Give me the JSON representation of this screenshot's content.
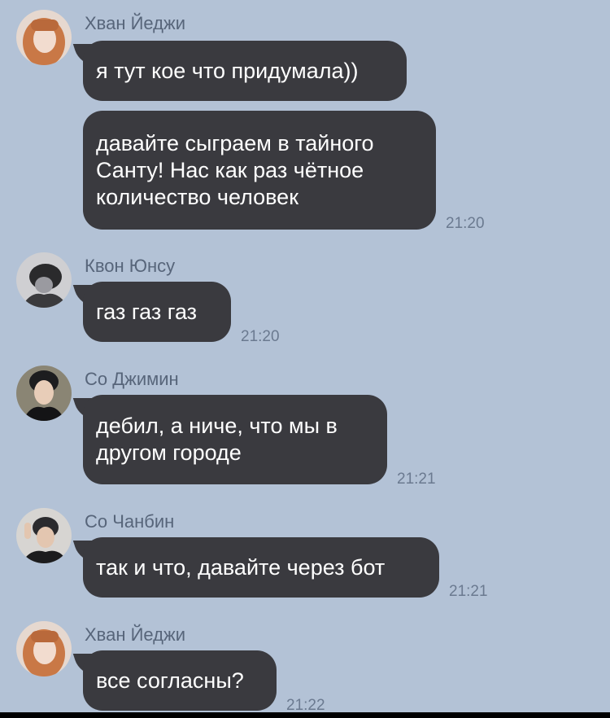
{
  "messages": [
    {
      "sender": "Хван Йеджи",
      "texts": [
        "я тут кое что придумала))",
        "давайте сыграем в тайного\nСанту! Нас как раз чётное\nколичество человек"
      ],
      "time": "21:20",
      "avatar": "user-avatar-yeji"
    },
    {
      "sender": "Квон Юнсу",
      "texts": [
        "газ газ газ"
      ],
      "time": "21:20",
      "avatar": "user-avatar-yunsu"
    },
    {
      "sender": "Со Джимин",
      "texts": [
        "дебил, а ниче, что мы в\nдругом городе"
      ],
      "time": "21:21",
      "avatar": "user-avatar-jimin"
    },
    {
      "sender": "Со Чанбин",
      "texts": [
        "так и что, давайте через бот"
      ],
      "time": "21:21",
      "avatar": "user-avatar-changbin"
    },
    {
      "sender": "Хван Йеджи",
      "texts": [
        "все согласны?"
      ],
      "time": "21:22",
      "avatar": "user-avatar-yeji"
    }
  ],
  "colors": {
    "background": "#b3c2d6",
    "bubble": "#3a3a3f",
    "bubble_text": "#ffffff",
    "sender_name": "#57657a",
    "timestamp": "#6b7a90"
  }
}
